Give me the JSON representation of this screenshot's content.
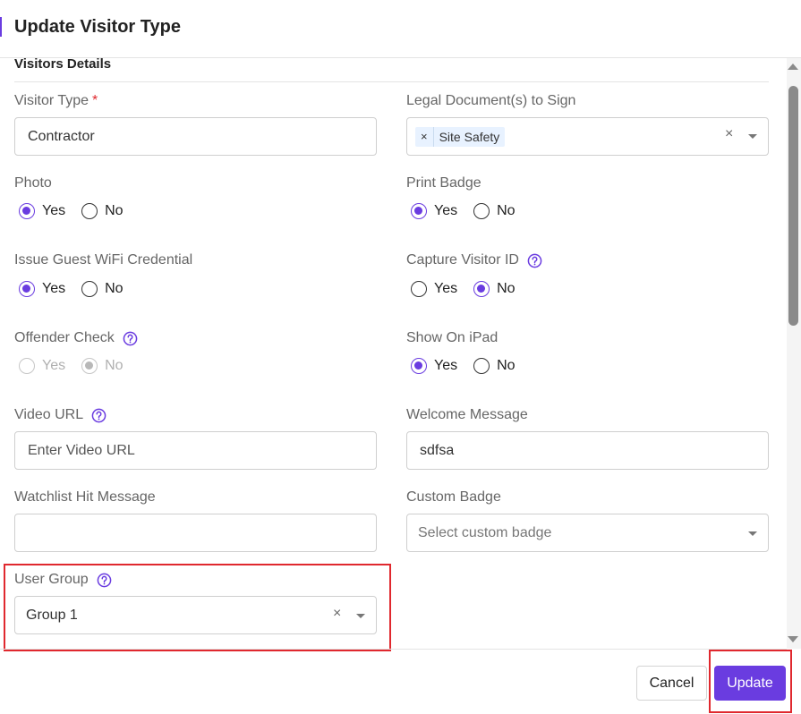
{
  "dialog": {
    "title": "Update Visitor Type"
  },
  "section": {
    "title": "Visitors Details"
  },
  "fields": {
    "visitor_type": {
      "label": "Visitor Type",
      "required_mark": "*",
      "value": "Contractor"
    },
    "legal_docs": {
      "label": "Legal Document(s) to Sign",
      "tag_remove": "×",
      "tag": "Site Safety",
      "clear": "×"
    },
    "photo": {
      "label": "Photo",
      "yes": "Yes",
      "no": "No",
      "selected": "Yes"
    },
    "print_badge": {
      "label": "Print Badge",
      "yes": "Yes",
      "no": "No",
      "selected": "Yes"
    },
    "guest_wifi": {
      "label": "Issue Guest WiFi Credential",
      "yes": "Yes",
      "no": "No",
      "selected": "Yes"
    },
    "capture_id": {
      "label": "Capture Visitor ID",
      "yes": "Yes",
      "no": "No",
      "selected": "No"
    },
    "offender_check": {
      "label": "Offender Check",
      "yes": "Yes",
      "no": "No",
      "selected": "No",
      "disabled": true
    },
    "show_ipad": {
      "label": "Show On iPad",
      "yes": "Yes",
      "no": "No",
      "selected": "Yes"
    },
    "video_url": {
      "label": "Video URL",
      "placeholder": "Enter Video URL"
    },
    "welcome_message": {
      "label": "Welcome Message",
      "value": "sdfsa"
    },
    "watchlist_message": {
      "label": "Watchlist Hit Message",
      "value": ""
    },
    "custom_badge": {
      "label": "Custom Badge",
      "placeholder": "Select custom badge"
    },
    "user_group": {
      "label": "User Group",
      "value": "Group 1",
      "clear": "×"
    }
  },
  "footer": {
    "cancel_label": "Cancel",
    "update_label": "Update"
  },
  "colors": {
    "accent": "#6a3ce0",
    "highlight": "#e0282e",
    "tag_bg": "#e8f2ff"
  }
}
